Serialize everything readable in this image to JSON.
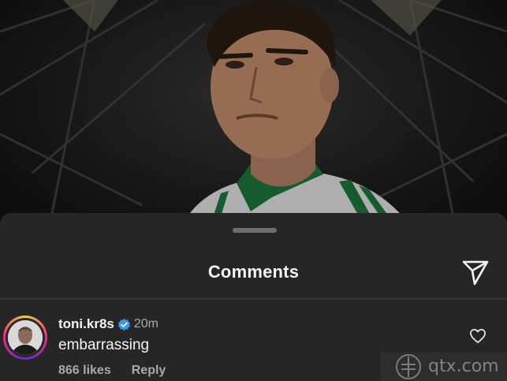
{
  "sheet": {
    "title": "Comments",
    "share_icon": "paper-plane-icon"
  },
  "comment": {
    "username": "toni.kr8s",
    "verified": true,
    "time": "20m",
    "text": "embarrassing",
    "likes": "866 likes",
    "reply_label": "Reply",
    "like_icon": "heart-outline-icon"
  },
  "watermark": {
    "text": "qtx.com"
  },
  "colors": {
    "sheet_background": "#262626",
    "primary_text": "#f5f5f5",
    "secondary_text": "#a8a8a8",
    "verified_blue": "#3897f0",
    "jersey_green": "#1e7a3c"
  }
}
